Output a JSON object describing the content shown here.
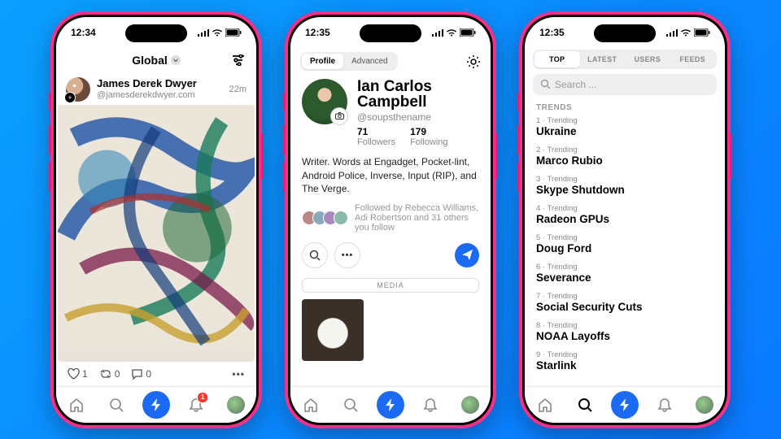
{
  "statusbar": {
    "time1": "12:34",
    "time2": "12:35",
    "time3": "12:35"
  },
  "phone1": {
    "header_title": "Global",
    "post": {
      "author": "James Derek Dwyer",
      "handle": "@jamesderekdwyer.com",
      "time": "22m",
      "likes": "1",
      "reposts": "0",
      "comments": "0"
    }
  },
  "phone2": {
    "tabs": {
      "profile": "Profile",
      "advanced": "Advanced"
    },
    "name": "Ian Carlos Campbell",
    "handle": "@soupsthename",
    "followers_n": "71",
    "followers_l": "Followers",
    "following_n": "179",
    "following_l": "Following",
    "bio": "Writer. Words at Engadget, Pocket-lint, Android Police, Inverse, Input (RIP), and The Verge.",
    "followed_by": "Followed by Rebecca Williams, Adi Robertson and 31 others you follow",
    "media_label": "MEDIA"
  },
  "phone3": {
    "tabs": {
      "top": "TOP",
      "latest": "LATEST",
      "users": "USERS",
      "feeds": "FEEDS"
    },
    "search_placeholder": "Search ...",
    "trends_label": "TRENDS",
    "trends": [
      {
        "sub": "1 · Trending",
        "main": "Ukraine"
      },
      {
        "sub": "2 · Trending",
        "main": "Marco Rubio"
      },
      {
        "sub": "3 · Trending",
        "main": "Skype Shutdown"
      },
      {
        "sub": "4 · Trending",
        "main": "Radeon GPUs"
      },
      {
        "sub": "5 · Trending",
        "main": "Doug Ford"
      },
      {
        "sub": "6 · Trending",
        "main": "Severance"
      },
      {
        "sub": "7 · Trending",
        "main": "Social Security Cuts"
      },
      {
        "sub": "8 · Trending",
        "main": "NOAA Layoffs"
      },
      {
        "sub": "9 · Trending",
        "main": "Starlink"
      }
    ]
  },
  "nav_badge": "1"
}
